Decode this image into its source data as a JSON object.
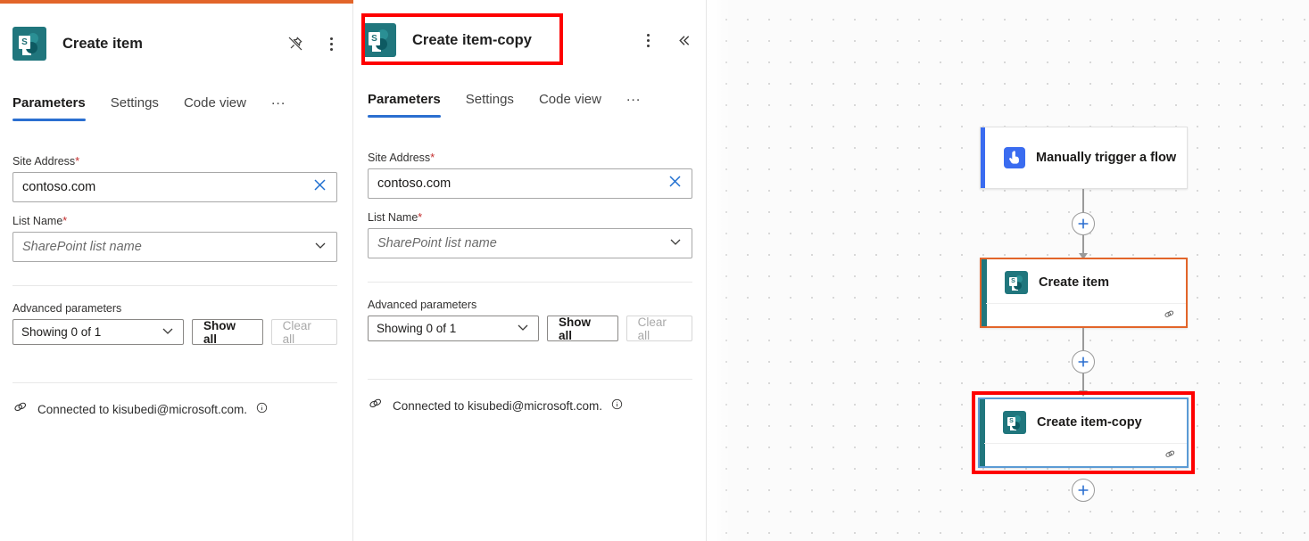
{
  "app": {
    "accent_orange": "#e2652a",
    "accent_blue": "#2b6fd0",
    "sharepoint_teal": "#20767d",
    "highlight_red": "#fe0000"
  },
  "panels": [
    {
      "id": "create-item",
      "title": "Create item",
      "icon": "sharepoint-icon",
      "pinned": false,
      "actions": {
        "pin_label": "Unpin",
        "more_label": "More commands"
      },
      "tabs": [
        {
          "label": "Parameters",
          "active": true
        },
        {
          "label": "Settings",
          "active": false
        },
        {
          "label": "Code view",
          "active": false
        },
        {
          "label": "...",
          "active": false
        }
      ],
      "fields": [
        {
          "label": "Site Address",
          "required": "*",
          "value": "contoso.com",
          "placeholder": "",
          "type": "text",
          "trailing_icon": "clear-icon"
        },
        {
          "label": "List Name",
          "required": "*",
          "value": "",
          "placeholder": "SharePoint list name",
          "type": "select",
          "trailing_icon": "chevron-down-icon"
        }
      ],
      "advanced": {
        "label": "Advanced parameters",
        "select_value": "Showing 0 of 1",
        "show_all_label": "Show all",
        "clear_all_label": "Clear all",
        "clear_all_disabled": true
      },
      "connection": {
        "text": "Connected to kisubedi@microsoft.com.",
        "icon": "link-icon",
        "info_icon": "info-icon"
      }
    },
    {
      "id": "create-item-copy",
      "title": "Create item-copy",
      "icon": "sharepoint-icon",
      "pinned": false,
      "actions": {
        "more_label": "More commands",
        "collapse_label": "Collapse"
      },
      "tabs": [
        {
          "label": "Parameters",
          "active": true
        },
        {
          "label": "Settings",
          "active": false
        },
        {
          "label": "Code view",
          "active": false
        },
        {
          "label": "...",
          "active": false
        }
      ],
      "fields": [
        {
          "label": "Site Address",
          "required": "*",
          "value": "contoso.com",
          "placeholder": "",
          "type": "text",
          "trailing_icon": "clear-icon"
        },
        {
          "label": "List Name",
          "required": "*",
          "value": "",
          "placeholder": "SharePoint list name",
          "type": "select",
          "trailing_icon": "chevron-down-icon"
        }
      ],
      "advanced": {
        "label": "Advanced parameters",
        "select_value": "Showing 0 of 1",
        "show_all_label": "Show all",
        "clear_all_label": "Clear all",
        "clear_all_disabled": true
      },
      "connection": {
        "text": "Connected to kisubedi@microsoft.com.",
        "icon": "link-icon",
        "info_icon": "info-icon"
      }
    }
  ],
  "canvas": {
    "nodes": [
      {
        "id": "trigger",
        "label": "Manually trigger a flow",
        "icon": "manual-trigger-icon",
        "accent": "#3a6cf0",
        "border": "#e1e1e1",
        "selected": false,
        "highlighted": false,
        "has_footer": false
      },
      {
        "id": "create-item",
        "label": "Create item",
        "icon": "sharepoint-icon",
        "accent": "#20767d",
        "border": "#e2652a",
        "selected": false,
        "highlighted": false,
        "has_footer": true
      },
      {
        "id": "create-item-copy",
        "label": "Create item-copy",
        "icon": "sharepoint-icon",
        "accent": "#20767d",
        "border": "#5b9bd5",
        "selected": true,
        "highlighted": true,
        "has_footer": true
      }
    ],
    "add_buttons": [
      {
        "id": "add-step-1",
        "label": "+"
      },
      {
        "id": "add-step-2",
        "label": "+"
      },
      {
        "id": "add-step-3",
        "label": "+"
      }
    ]
  }
}
